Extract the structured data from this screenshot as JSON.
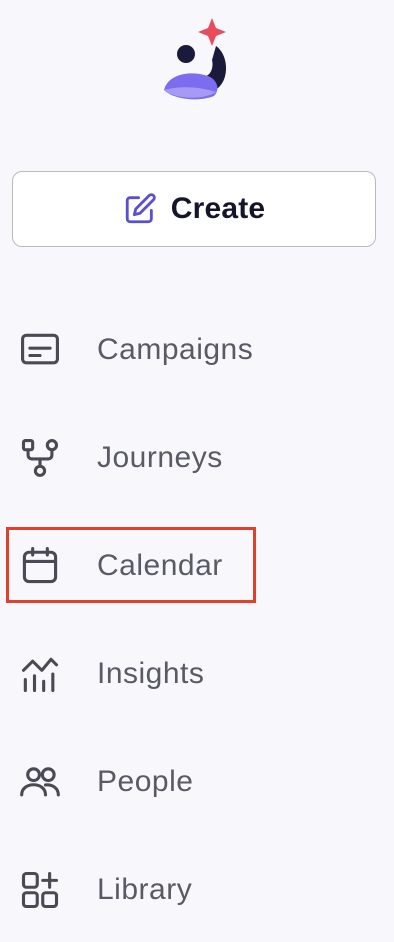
{
  "logo": {
    "icon": "brand-logo-icon",
    "accent_color": "#e94c5c",
    "brand_color": "#7b6cf0",
    "dark_color": "#1a1a3a"
  },
  "create_button": {
    "label": "Create",
    "icon": "edit-icon",
    "icon_color": "#5a4fcf"
  },
  "nav": {
    "items": [
      {
        "label": "Campaigns",
        "icon": "campaigns-icon"
      },
      {
        "label": "Journeys",
        "icon": "journeys-icon"
      },
      {
        "label": "Calendar",
        "icon": "calendar-icon",
        "highlighted": true
      },
      {
        "label": "Insights",
        "icon": "insights-icon"
      },
      {
        "label": "People",
        "icon": "people-icon"
      },
      {
        "label": "Library",
        "icon": "library-icon"
      }
    ]
  },
  "colors": {
    "background": "#f8f8fc",
    "text": "#5a5a66",
    "icon": "#4a4a55",
    "highlight": "#e0402e"
  }
}
